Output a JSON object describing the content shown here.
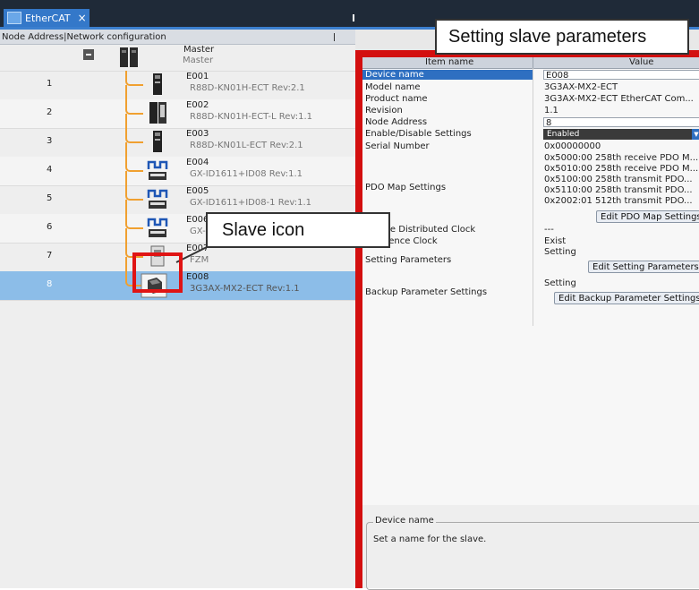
{
  "tab": {
    "label": "EtherCAT",
    "close": "×",
    "icon": "ethercat-tab-icon"
  },
  "left_panel": {
    "header": "Node Address|Network configuration",
    "master": {
      "name": "Master",
      "sub": "Master"
    },
    "slaves": [
      {
        "node": "1",
        "name": "E001",
        "model": "R88D-KN01H-ECT Rev:2.1"
      },
      {
        "node": "2",
        "name": "E002",
        "model": "R88D-KN01H-ECT-L Rev:1.1"
      },
      {
        "node": "3",
        "name": "E003",
        "model": "R88D-KN01L-ECT Rev:2.1"
      },
      {
        "node": "4",
        "name": "E004",
        "model": "GX-ID1611+ID08 Rev:1.1"
      },
      {
        "node": "5",
        "name": "E005",
        "model": "GX-ID1611+ID08-1 Rev:1.1"
      },
      {
        "node": "6",
        "name": "E006",
        "model": "GX-"
      },
      {
        "node": "7",
        "name": "E007",
        "model": "FZM"
      },
      {
        "node": "8",
        "name": "E008",
        "model": "3G3AX-MX2-ECT Rev:1.1",
        "selected": true
      }
    ]
  },
  "properties": {
    "col_item": "Item name",
    "col_value": "Value",
    "device_name": {
      "label": "Device name",
      "value": "E008"
    },
    "model_name": {
      "label": "Model name",
      "value": "3G3AX-MX2-ECT"
    },
    "product_name": {
      "label": "Product name",
      "value": "3G3AX-MX2-ECT EtherCAT Com..."
    },
    "revision": {
      "label": "Revision",
      "value": "1.1"
    },
    "node_address": {
      "label": "Node Address",
      "value": "8"
    },
    "enable_disable": {
      "label": "Enable/Disable Settings",
      "value": "Enabled"
    },
    "serial_number": {
      "label": "Serial Number",
      "value": "0x00000000"
    },
    "pdo_map": {
      "label": "PDO Map Settings",
      "values": [
        "0x5000:00 258th receive PDO M...",
        "0x5010:00 258th receive PDO M...",
        "0x5100:00 258th transmit PDO...",
        "0x5110:00 258th transmit PDO...",
        "0x2002:01 512th transmit PDO..."
      ],
      "button": "Edit PDO Map Settings"
    },
    "distributed_clock": {
      "label": "Enable Distributed Clock",
      "value": "---"
    },
    "reference_clock": {
      "label": "Reference Clock",
      "value": "Exist"
    },
    "setting_parameters": {
      "label": "Setting Parameters",
      "value": "Setting",
      "button": "Edit Setting Parameters"
    },
    "backup_parameters": {
      "label": "Backup Parameter Settings",
      "value": "Setting",
      "button": "Edit Backup Parameter Settings"
    }
  },
  "description": {
    "title": "Device name",
    "text": "Set a name for the slave."
  },
  "callouts": {
    "top": "Setting slave parameters",
    "slave_icon": "Slave icon"
  },
  "colors": {
    "accent_red": "#e01414",
    "selection_blue": "#8cbde8",
    "bus_orange": "#f0a030"
  }
}
